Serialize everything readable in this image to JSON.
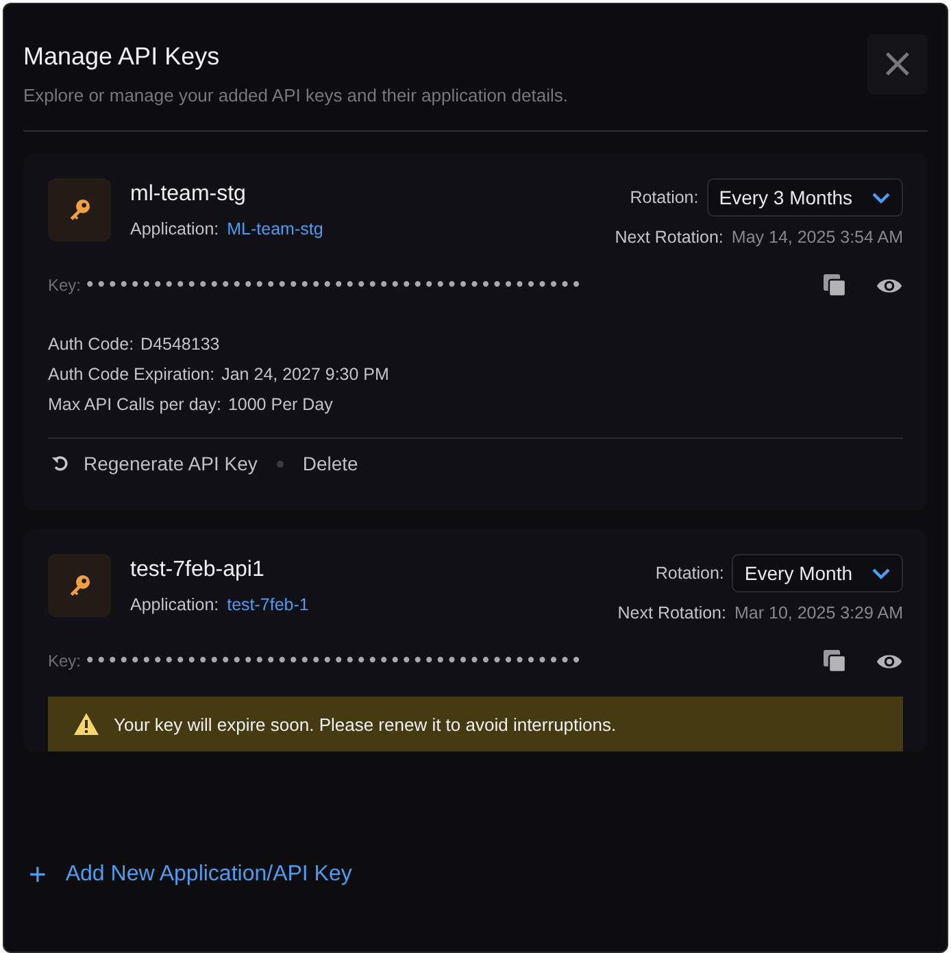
{
  "dialog": {
    "title": "Manage API Keys",
    "subtitle": "Explore or manage your added API keys and their application details.",
    "close": "×"
  },
  "keys": [
    {
      "name": "ml-team-stg",
      "application_label": "Application:",
      "application": "ML-team-stg",
      "rotation_label": "Rotation:",
      "rotation": "Every 3 Months",
      "next_label": "Next Rotation:",
      "next": "May 14, 2025 3:54 AM",
      "key_label": "Key:",
      "key": "••••••••••••••••••••••••••••••••••••••••••••",
      "details": [
        {
          "label": "Auth Code:",
          "value": "D4548133"
        },
        {
          "label": "Auth Code Expiration:",
          "value": "Jan 24, 2027 9:30 PM"
        },
        {
          "label": "Max API Calls per day:",
          "value": "1000 Per Day"
        }
      ],
      "actions": [
        "Regenerate API Key",
        "Delete"
      ]
    },
    {
      "name": "test-7feb-api1",
      "application_label": "Application:",
      "application": "test-7feb-1",
      "rotation_label": "Rotation:",
      "rotation": "Every Month",
      "next_label": "Next Rotation:",
      "next": "Mar 10, 2025 3:29 AM",
      "key_label": "Key:",
      "key": "••••••••••••••••••••••••••••••••••••••••••••",
      "warning": "Your key will expire soon. Please renew it to avoid interruptions."
    }
  ],
  "add_link": {
    "icon": "+",
    "label": "Add New Application/API Key"
  }
}
